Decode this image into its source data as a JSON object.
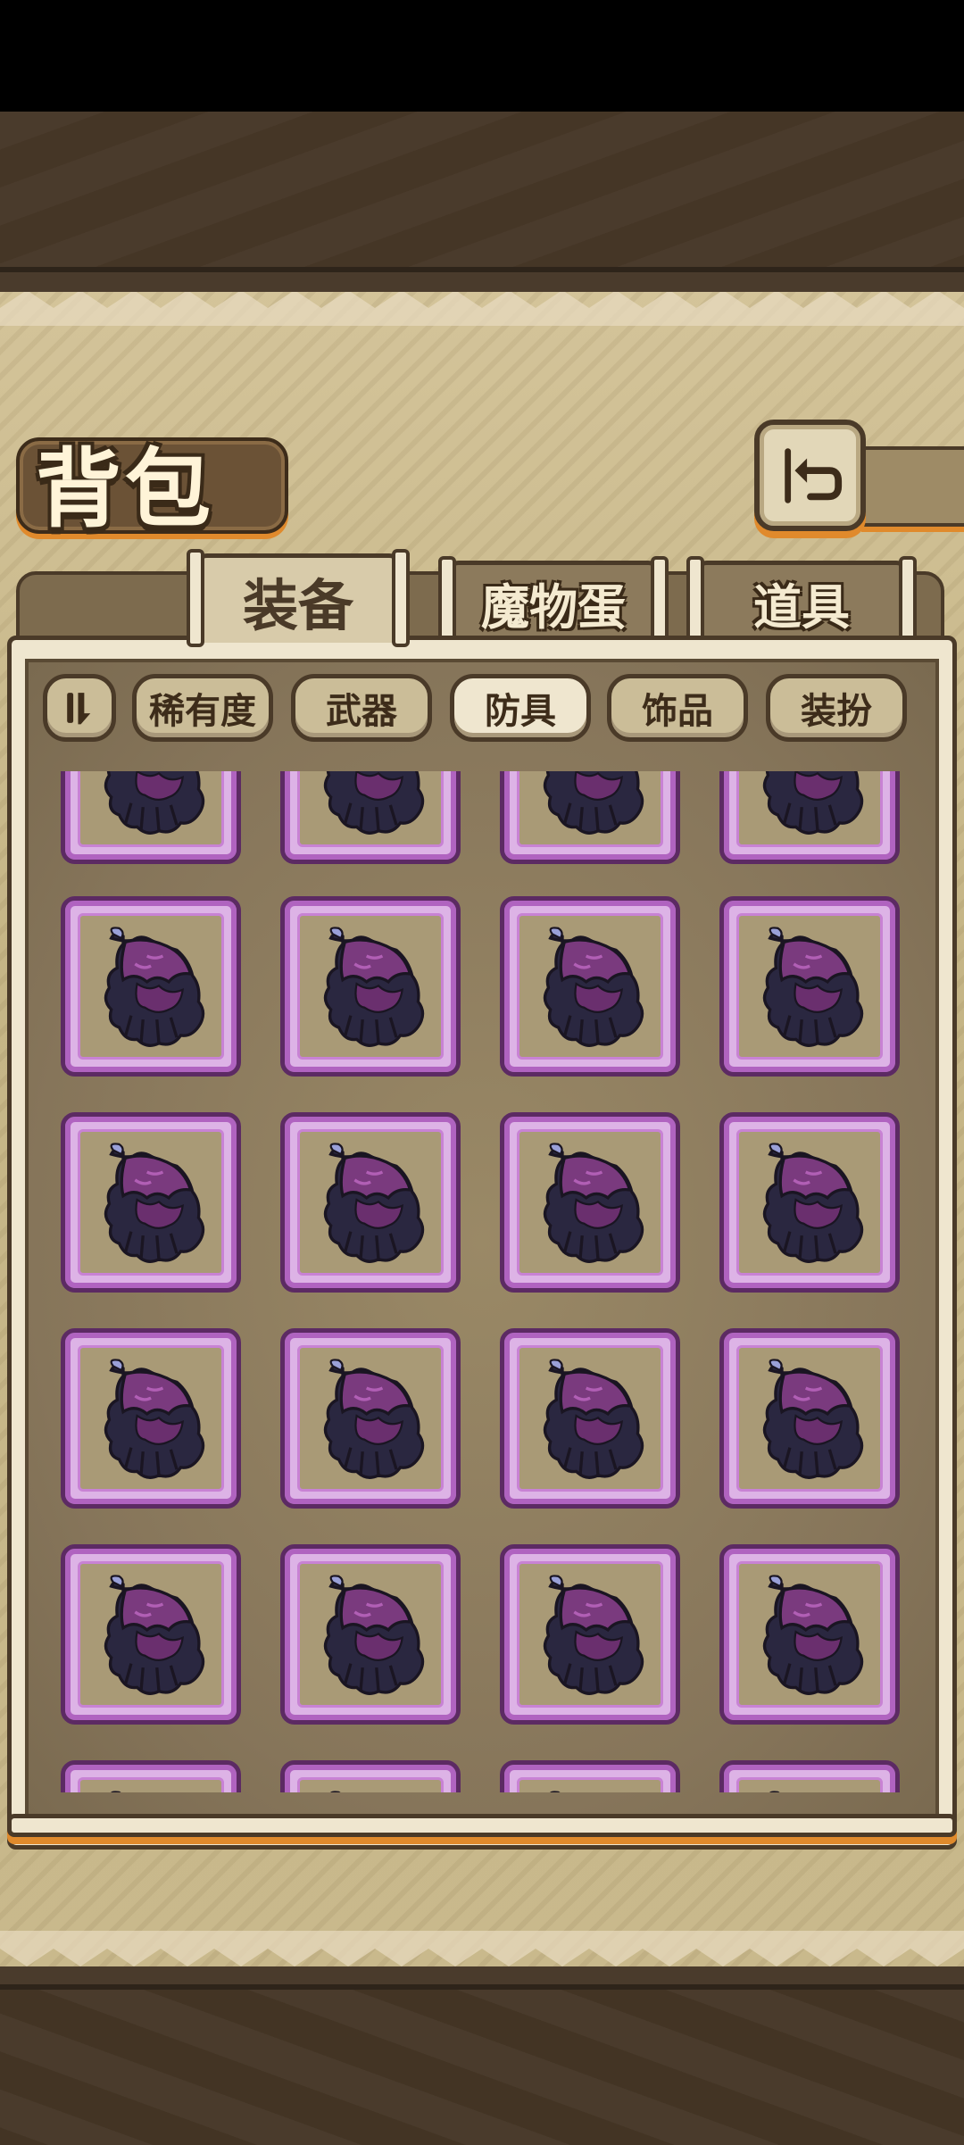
{
  "header": {
    "title": "背包"
  },
  "tabs": [
    {
      "label": "装备",
      "active": true
    },
    {
      "label": "魔物蛋",
      "active": false
    },
    {
      "label": "道具",
      "active": false
    }
  ],
  "filters": [
    {
      "label": "稀有度",
      "active": false
    },
    {
      "label": "武器",
      "active": false
    },
    {
      "label": "防具",
      "active": true
    },
    {
      "label": "饰品",
      "active": false
    },
    {
      "label": "装扮",
      "active": false
    }
  ],
  "sort_icon": "sort-toggle-icon",
  "back_icon": "back-arrow-icon",
  "item_icon": "purple-feather-cloak-icon",
  "colors": {
    "slot_border": "#b063c0",
    "accent": "#e08a2c",
    "panel": "#c9b98c"
  }
}
